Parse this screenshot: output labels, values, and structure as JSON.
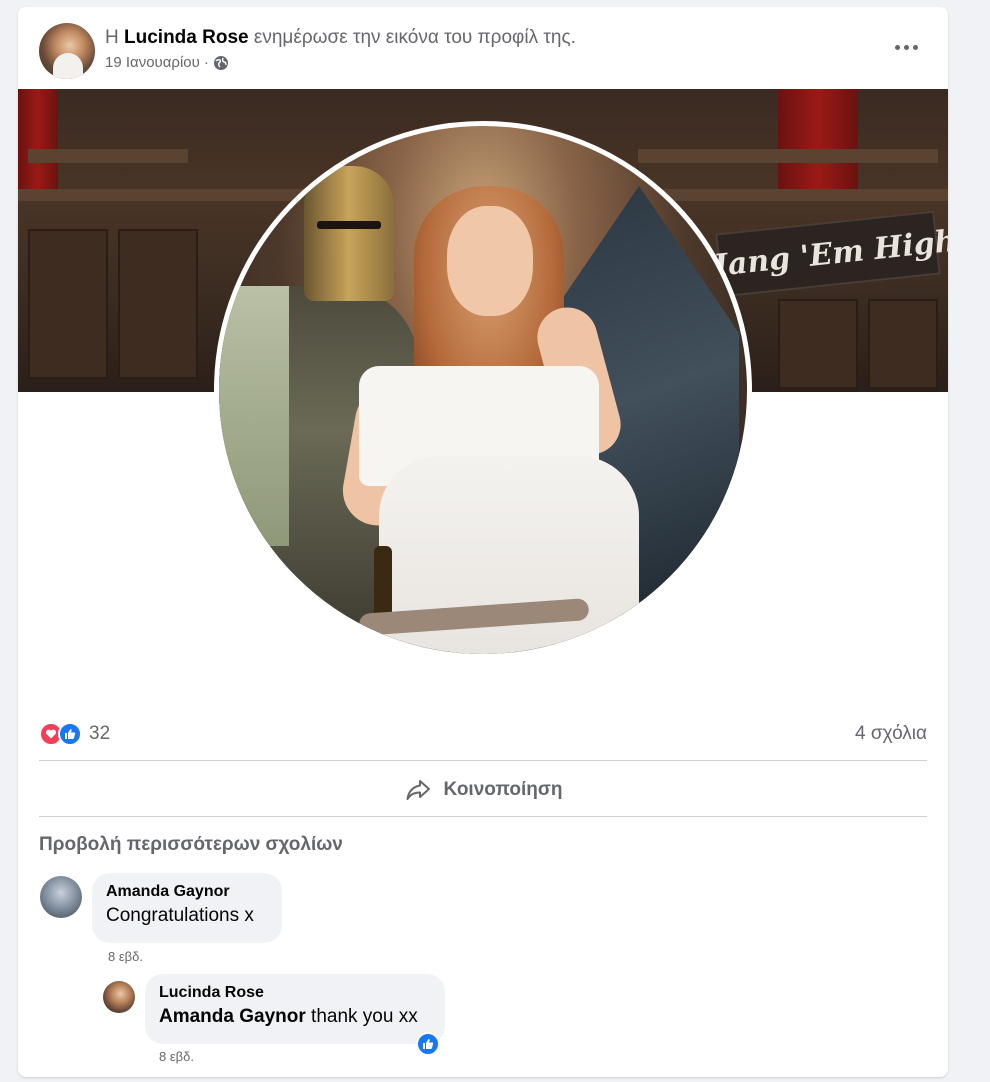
{
  "post": {
    "header_prefix": "Η",
    "author": "Lucinda Rose",
    "header_action": "ενημέρωσε την εικόνα του προφίλ της.",
    "date": "19 Ιανουαρίου",
    "separator": "·",
    "privacy_icon": "globe-icon",
    "more_icon": "more-horizontal-icon"
  },
  "cover": {
    "sign_text": "Hang 'Em High"
  },
  "stats": {
    "reaction_icons": [
      "love-reaction-icon",
      "like-reaction-icon"
    ],
    "reaction_count": "32",
    "comment_count": "4 σχόλια"
  },
  "actions": {
    "share_label": "Κοινοποίηση",
    "share_icon": "share-arrow-icon"
  },
  "comments_section": {
    "view_more": "Προβολή περισσότερων σχολίων",
    "comments": [
      {
        "author": "Amanda Gaynor",
        "text": "Congratulations x",
        "time": "8 εβδ."
      },
      {
        "author": "Lucinda Rose",
        "mention": "Amanda Gaynor",
        "text": "thank you xx",
        "time": "8 εβδ.",
        "reaction_icon": "like-reaction-icon"
      }
    ]
  },
  "colors": {
    "page_bg": "#f0f2f5",
    "secondary_text": "#65676b",
    "like_blue": "#1877f2",
    "love_red": "#f33e58"
  }
}
